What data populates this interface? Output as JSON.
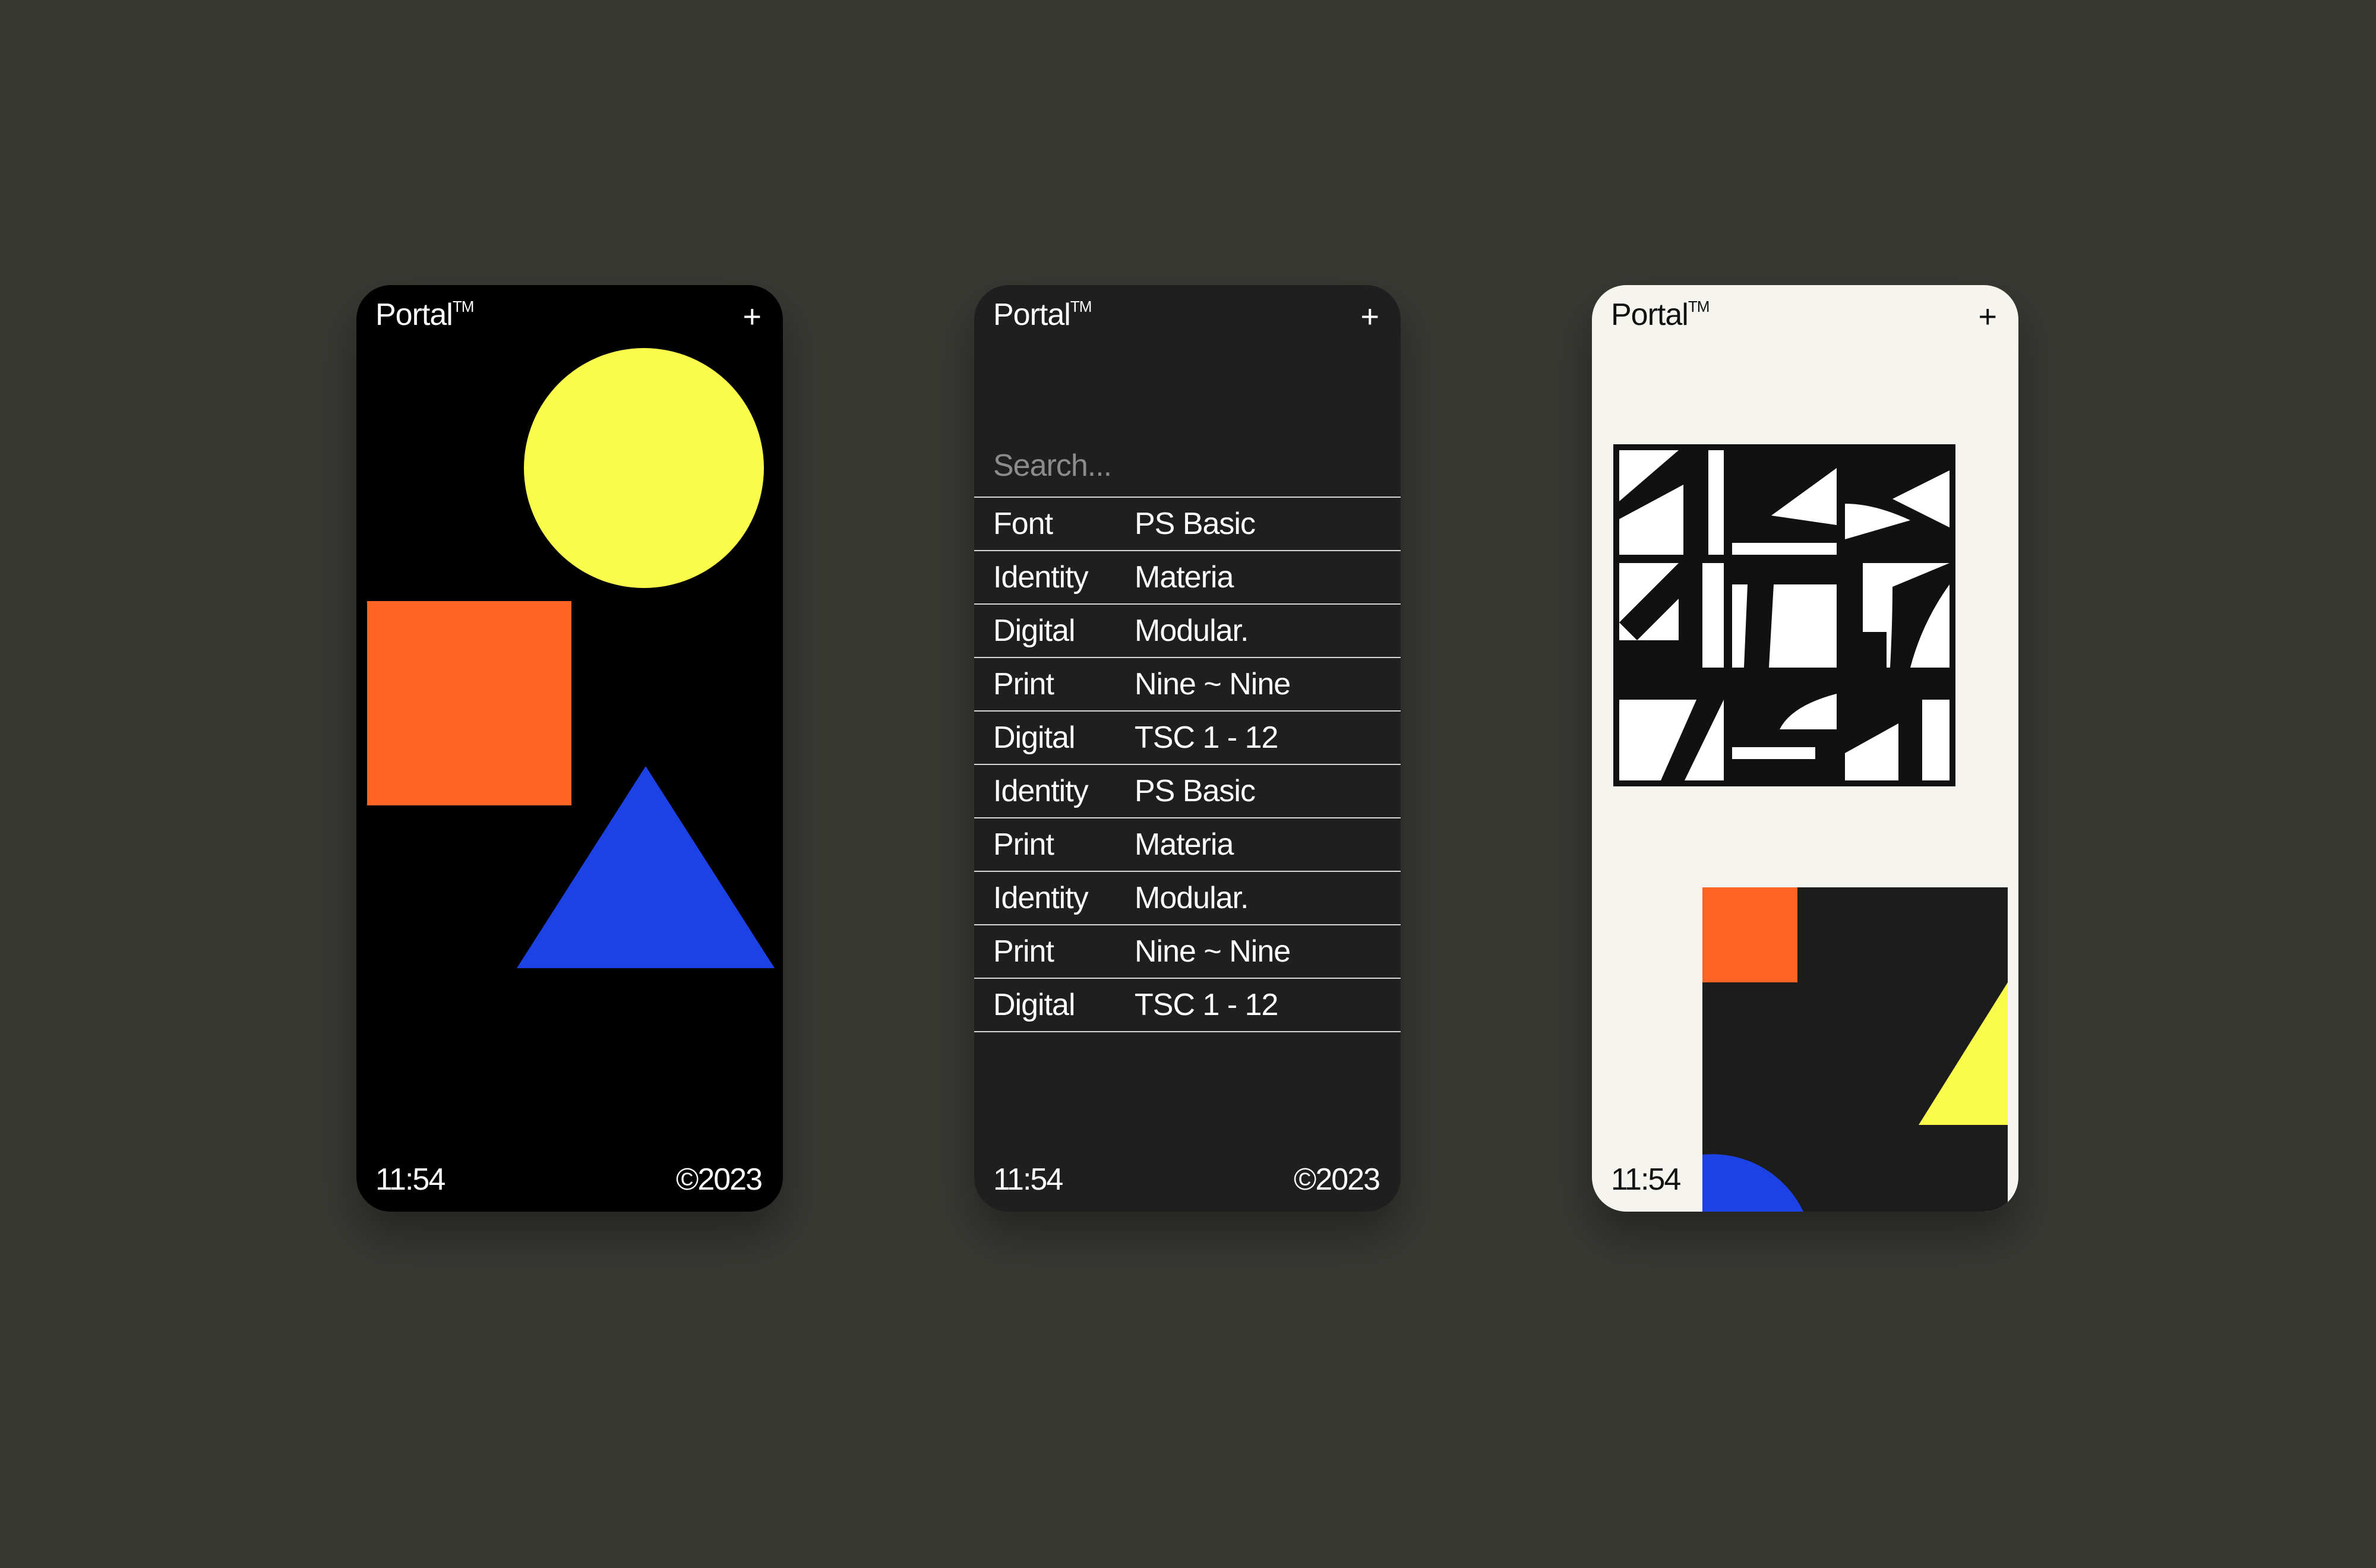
{
  "screens": [
    {
      "brand": "Portal",
      "trademark": "TM",
      "plus": "+",
      "time": "11:54",
      "copyright": "©2023"
    },
    {
      "brand": "Portal",
      "trademark": "TM",
      "plus": "+",
      "time": "11:54",
      "copyright": "©2023",
      "search_placeholder": "Search...",
      "rows": [
        {
          "category": "Font",
          "project": "PS Basic"
        },
        {
          "category": "Identity",
          "project": "Materia"
        },
        {
          "category": "Digital",
          "project": "Modular."
        },
        {
          "category": "Print",
          "project": "Nine ~ Nine"
        },
        {
          "category": "Digital",
          "project": "TSC 1 - 12"
        },
        {
          "category": "Identity",
          "project": "PS Basic"
        },
        {
          "category": "Print",
          "project": "Materia"
        },
        {
          "category": "Identity",
          "project": "Modular."
        },
        {
          "category": "Print",
          "project": "Nine ~ Nine"
        },
        {
          "category": "Digital",
          "project": "TSC 1 - 12"
        }
      ]
    },
    {
      "brand": "Portal",
      "trademark": "TM",
      "plus": "+",
      "time": "11:54"
    }
  ],
  "colors": {
    "background": "#383833",
    "yellow": "#fbfb4b",
    "orange": "#ff6424",
    "blue": "#1c42e6",
    "phone_black": "#000000",
    "phone_dark": "#1f1f1f",
    "phone_light": "#f5f4ef"
  }
}
